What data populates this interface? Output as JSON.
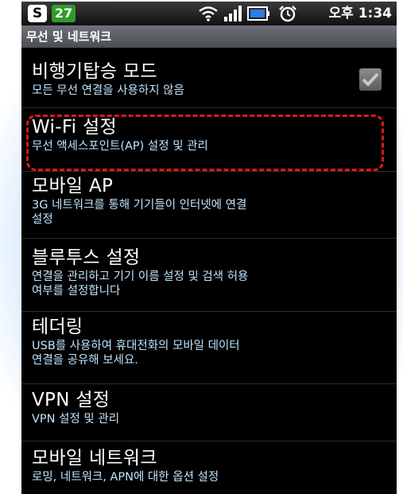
{
  "status_bar": {
    "badge_s": "S",
    "badge_number": "27",
    "time": "오후 1:34"
  },
  "section_title": "무선 및 네트워크",
  "items": [
    {
      "title": "비행기탑승 모드",
      "summary": "모든 무선 연결을 사용하지 않음",
      "checkbox": true
    },
    {
      "title": "Wi-Fi 설정",
      "summary": "무선 액세스포인트(AP) 설정 및 관리"
    },
    {
      "title": "모바일 AP",
      "summary_line1": "3G 네트워크를 통해 기기들이 인터넷에 연결",
      "summary_line2": "설정"
    },
    {
      "title": "블루투스 설정",
      "summary_line1": "연결을 관리하고 기기 이름 설정 및 검색 허용",
      "summary_line2": "여부를 설정합니다"
    },
    {
      "title": "테더링",
      "summary_line1": "USB를 사용하여 휴대전화의 모바일 데이터",
      "summary_line2": "연결을 공유해 보세요."
    },
    {
      "title": "VPN 설정",
      "summary": "VPN 설정 및 관리"
    },
    {
      "title": "모바일 네트워크",
      "summary": "로밍, 네트워크, APN에 대한 옵션 설정"
    }
  ],
  "colors": {
    "highlight_border": "#e01818",
    "summary_text": "#bfe4ff",
    "status_badge_green": "#2f9c2a"
  }
}
